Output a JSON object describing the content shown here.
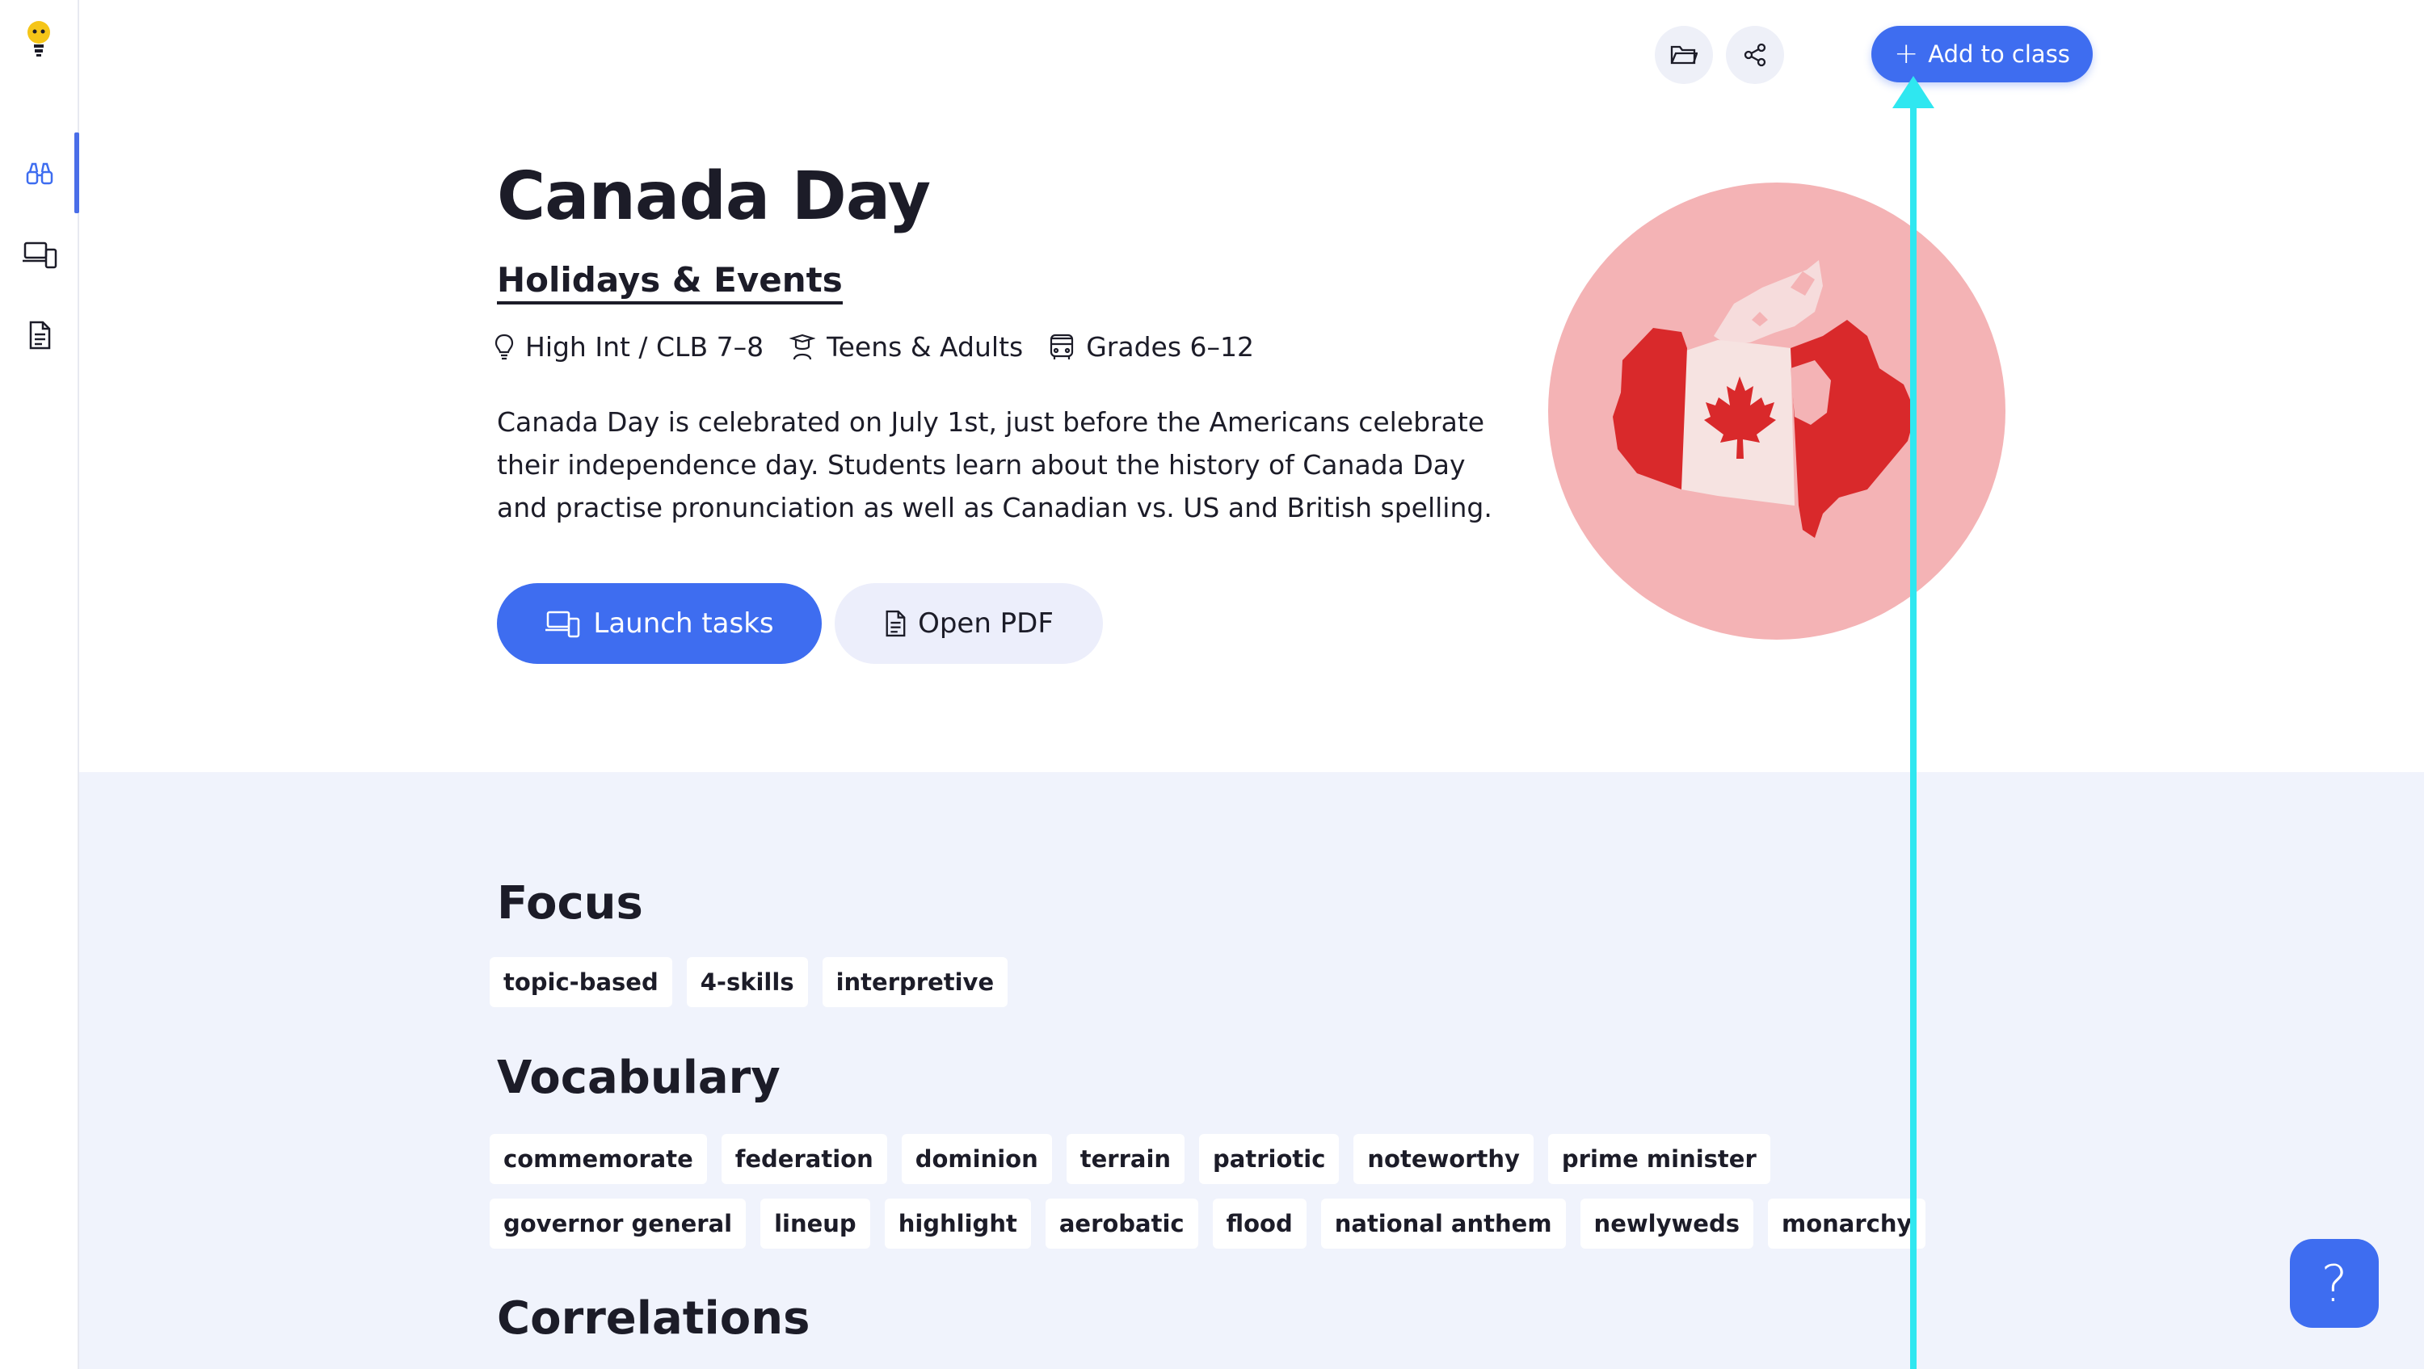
{
  "sidebar": {
    "items": [
      {
        "name": "binoculars-icon"
      },
      {
        "name": "devices-icon"
      },
      {
        "name": "document-icon"
      }
    ]
  },
  "header": {
    "add_to_class": "Add to class"
  },
  "lesson": {
    "title": "Canada Day",
    "category": "Holidays & Events",
    "meta": {
      "level": "High Int / CLB 7–8",
      "audience": "Teens & Adults",
      "grades": "Grades 6–12"
    },
    "description": "Canada Day is celebrated on July 1st, just before the Americans celebrate their independence day. Students learn about the history of Canada Day and practise pronunciation as well as Canadian vs. US and British spelling.",
    "launch_label": "Launch tasks",
    "pdf_label": "Open PDF"
  },
  "sections": {
    "focus": {
      "title": "Focus",
      "tags": [
        "topic-based",
        "4-skills",
        "interpretive"
      ]
    },
    "vocabulary": {
      "title": "Vocabulary",
      "tags": [
        "commemorate",
        "federation",
        "dominion",
        "terrain",
        "patriotic",
        "noteworthy",
        "prime minister",
        "governor general",
        "lineup",
        "highlight",
        "aerobatic",
        "flood",
        "national anthem",
        "newlyweds",
        "monarchy"
      ]
    },
    "correlations": {
      "title": "Correlations"
    }
  },
  "help": {
    "label": "?"
  },
  "colors": {
    "accent": "#3e6df0",
    "lower_bg": "#f0f3fc",
    "image_circle": "#f4b3b5",
    "flag_red": "#d9292b",
    "cursor": "#2fe7f0"
  }
}
